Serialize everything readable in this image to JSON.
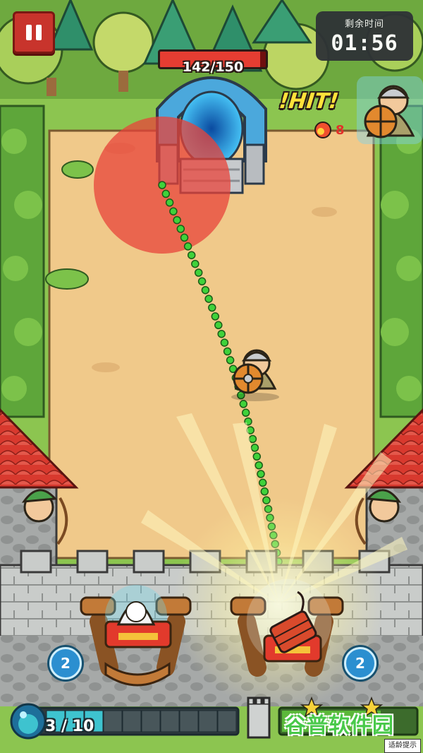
{
  "hud": {
    "timer_label": "剩余时间",
    "timer_value": "01:56",
    "portal_hp_current": 142,
    "portal_hp_max": 150,
    "portal_hp_text": "142/150",
    "hit_text": "!HIT!",
    "hit_count": "8",
    "energy_text": "3 / 10",
    "energy_current": 3,
    "energy_max": 10
  },
  "launchers": [
    {
      "ammo": "2"
    },
    {
      "ammo": "2"
    }
  ],
  "overlay": {
    "watermark": "谷普软件园",
    "age_tip": "适龄提示"
  },
  "colors": {
    "grass": "#8cc550",
    "dirt": "#f0c98a",
    "wall": "#c9ccca",
    "hp_fill": "#e53d32",
    "trajectory": "#3fd23a",
    "energy_fill": "#3ec3cf",
    "roof": "#d8392e"
  },
  "icons": [
    "pause-icon",
    "energy-orb-icon",
    "tower-icon",
    "star-icon",
    "fire-icon"
  ]
}
